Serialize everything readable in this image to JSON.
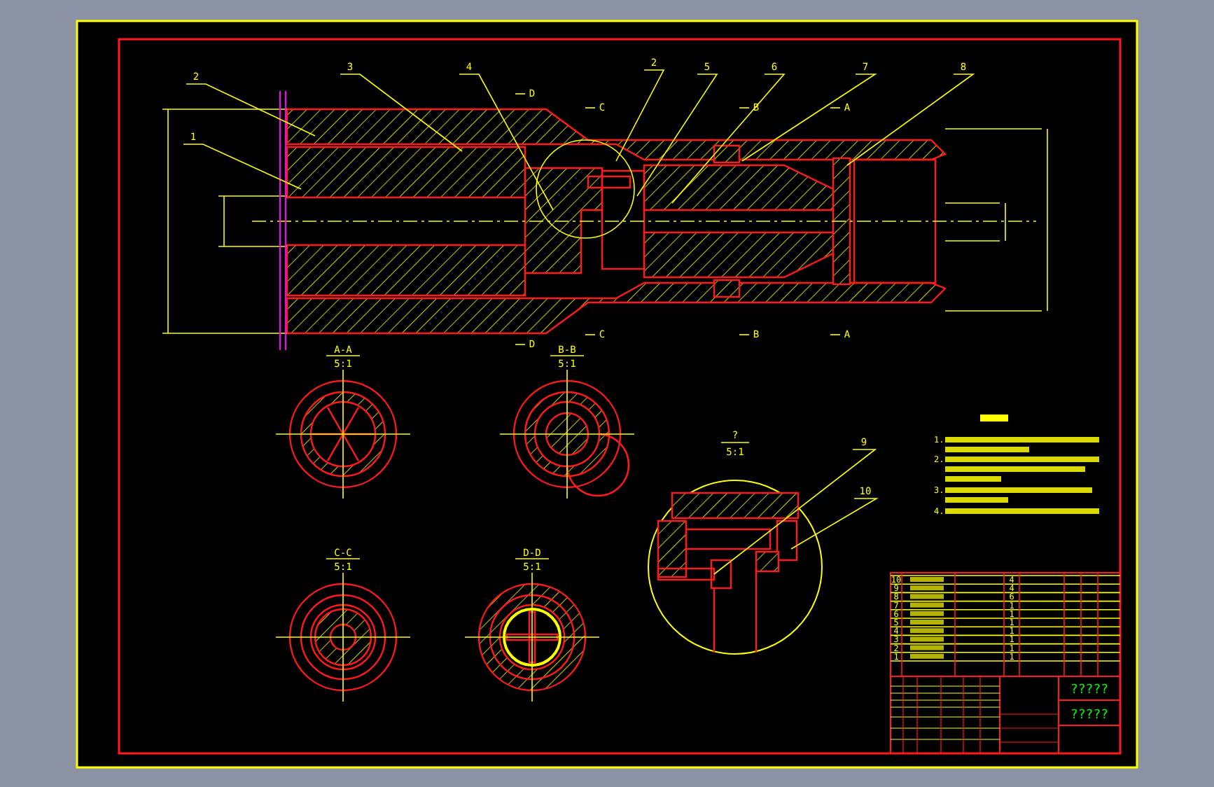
{
  "main_view": {
    "balloons": [
      {
        "label": "2"
      },
      {
        "label": "1"
      },
      {
        "label": "3"
      },
      {
        "label": "4"
      },
      {
        "label": "2"
      },
      {
        "label": "5"
      },
      {
        "label": "6"
      },
      {
        "label": "7"
      },
      {
        "label": "8"
      }
    ],
    "section_marks": [
      {
        "label": "D"
      },
      {
        "label": "C"
      },
      {
        "label": "B"
      },
      {
        "label": "A"
      },
      {
        "label": "D"
      },
      {
        "label": "C"
      },
      {
        "label": "B"
      },
      {
        "label": "A"
      }
    ]
  },
  "sections": [
    {
      "title": "A-A",
      "scale": "5:1",
      "kind": "spokes"
    },
    {
      "title": "B-B",
      "scale": "5:1",
      "kind": "spiral"
    },
    {
      "title": "C-C",
      "scale": "5:1",
      "kind": "solid"
    },
    {
      "title": "D-D",
      "scale": "5:1",
      "kind": "cross"
    }
  ],
  "detail": {
    "title": "?",
    "scale": "5:1",
    "balloons": [
      {
        "label": "9"
      },
      {
        "label": "10"
      }
    ]
  },
  "notes": {
    "items": [
      {
        "number": "1."
      },
      {
        "number": "2."
      },
      {
        "number": "3."
      },
      {
        "number": "4."
      }
    ]
  },
  "parts_list": {
    "rows": [
      {
        "number": "10",
        "quantity": "4"
      },
      {
        "number": "9",
        "quantity": "4"
      },
      {
        "number": "8",
        "quantity": "6"
      },
      {
        "number": "7",
        "quantity": "1"
      },
      {
        "number": "6",
        "quantity": "1"
      },
      {
        "number": "5",
        "quantity": "1"
      },
      {
        "number": "4",
        "quantity": "1"
      },
      {
        "number": "3",
        "quantity": "1"
      },
      {
        "number": "2",
        "quantity": "1"
      },
      {
        "number": "1",
        "quantity": "1"
      }
    ]
  },
  "title_block": {
    "texts": [
      "?????",
      "?????"
    ]
  }
}
